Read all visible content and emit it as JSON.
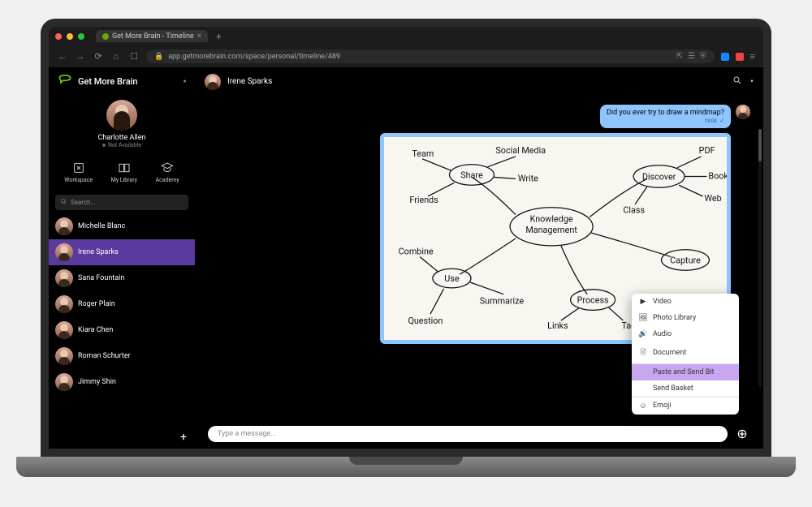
{
  "browser": {
    "tab_title": "Get More Brain - Timeline",
    "url": "app.getmorebrain.com/space/personal/timeline/489"
  },
  "brand": {
    "name": "Get More Brain"
  },
  "profile": {
    "name": "Charlotte Allen",
    "status": "Not Available"
  },
  "nav": {
    "workspace": "Workspace",
    "library": "My Library",
    "academy": "Academy"
  },
  "search": {
    "placeholder": "Search..."
  },
  "contacts": [
    {
      "name": "Michelle Blanc",
      "active": false
    },
    {
      "name": "Irene Sparks",
      "active": true
    },
    {
      "name": "Sana Fountain",
      "active": false
    },
    {
      "name": "Roger Plain",
      "active": false
    },
    {
      "name": "Kiara Chen",
      "active": false
    },
    {
      "name": "Roman Schurter",
      "active": false
    },
    {
      "name": "Jimmy Shin",
      "active": false
    }
  ],
  "chat": {
    "header_name": "Irene Sparks",
    "message_text": "Did you ever try to draw a mindmap?",
    "message_time": "19:00",
    "input_placeholder": "Type a message..."
  },
  "mindmap": {
    "center": "Knowledge Management",
    "nodes": {
      "share": {
        "label": "Share",
        "leaves": [
          "Team",
          "Social Media",
          "Write",
          "Friends"
        ]
      },
      "discover": {
        "label": "Discover",
        "leaves": [
          "PDF",
          "Book",
          "Web",
          "Class"
        ]
      },
      "capture": {
        "label": "Capture",
        "leaves": []
      },
      "process": {
        "label": "Process",
        "leaves": [
          "Links",
          "Tags"
        ]
      },
      "use": {
        "label": "Use",
        "leaves": [
          "Combine",
          "Summarize",
          "Question"
        ]
      }
    }
  },
  "menu": {
    "items": [
      {
        "icon": "video",
        "label": "Video"
      },
      {
        "icon": "photo",
        "label": "Photo Library"
      },
      {
        "icon": "audio",
        "label": "Audio"
      },
      {
        "icon": "document",
        "label": "Document"
      },
      {
        "icon": "paste",
        "label": "Paste and Send Bit",
        "highlighted": true
      },
      {
        "icon": "basket",
        "label": "Send Basket"
      },
      {
        "icon": "emoji",
        "label": "Emoji"
      }
    ]
  }
}
